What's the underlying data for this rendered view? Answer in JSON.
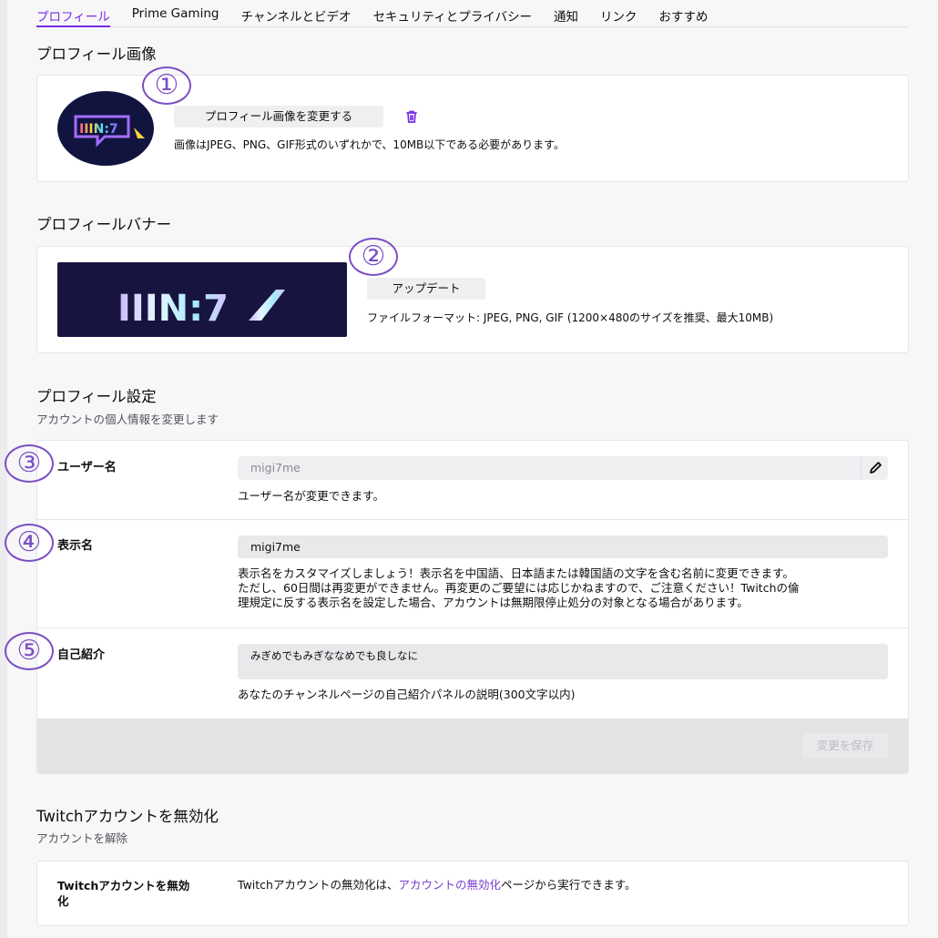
{
  "tabs": [
    {
      "label": "プロフィール",
      "active": true
    },
    {
      "label": "Prime Gaming"
    },
    {
      "label": "チャンネルとビデオ"
    },
    {
      "label": "セキュリティとプライバシー"
    },
    {
      "label": "通知"
    },
    {
      "label": "リンク"
    },
    {
      "label": "おすすめ"
    }
  ],
  "profile_image": {
    "heading": "プロフィール画像",
    "change_button": "プロフィール画像を変更する",
    "hint": "画像はJPEG、PNG、GIF形式のいずれかで、10MB以下である必要があります。",
    "marker": "①",
    "logo_text": "IIIN:7"
  },
  "banner": {
    "heading": "プロフィールバナー",
    "update_button": "アップデート",
    "hint": "ファイルフォーマット: JPEG, PNG, GIF (1200×480のサイズを推奨、最大10MB)",
    "marker": "②",
    "logo_text": "IIIN:7"
  },
  "settings": {
    "heading": "プロフィール設定",
    "subheading": "アカウントの個人情報を変更します",
    "username": {
      "marker": "③",
      "label": "ユーザー名",
      "value": "migi7me",
      "hint": "ユーザー名が変更できます。"
    },
    "display_name": {
      "marker": "④",
      "label": "表示名",
      "value": "migi7me",
      "hint_lines": [
        "表示名をカスタマイズしましょう！表示名を中国語、日本語または韓国語の文字を含む名前に変更できます。",
        "ただし、60日間は再変更ができません。再変更のご要望には応じかねますので、ご注意ください！Twitchの倫",
        "理規定に反する表示名を設定した場合、アカウントは無期限停止処分の対象となる場合があります。"
      ]
    },
    "bio": {
      "marker": "⑤",
      "label": "自己紹介",
      "value": "みぎめでもみぎななめでも良しなに",
      "hint": "あなたのチャンネルページの自己紹介パネルの説明(300文字以内)"
    },
    "save_button": "変更を保存"
  },
  "deactivate": {
    "heading": "Twitchアカウントを無効化",
    "subheading": "アカウントを解除",
    "row_label_line1": "Twitchアカウントを無効",
    "row_label_line2": "化",
    "text_before": "Twitchアカウントの無効化は、",
    "link_text": "アカウントの無効化",
    "text_after": "ページから実行できます。"
  },
  "colors": {
    "accent": "#772ce8",
    "marker": "#7b4fc4",
    "link": "#7a3bd0"
  },
  "icons": [
    "trash-icon",
    "pencil-icon"
  ]
}
